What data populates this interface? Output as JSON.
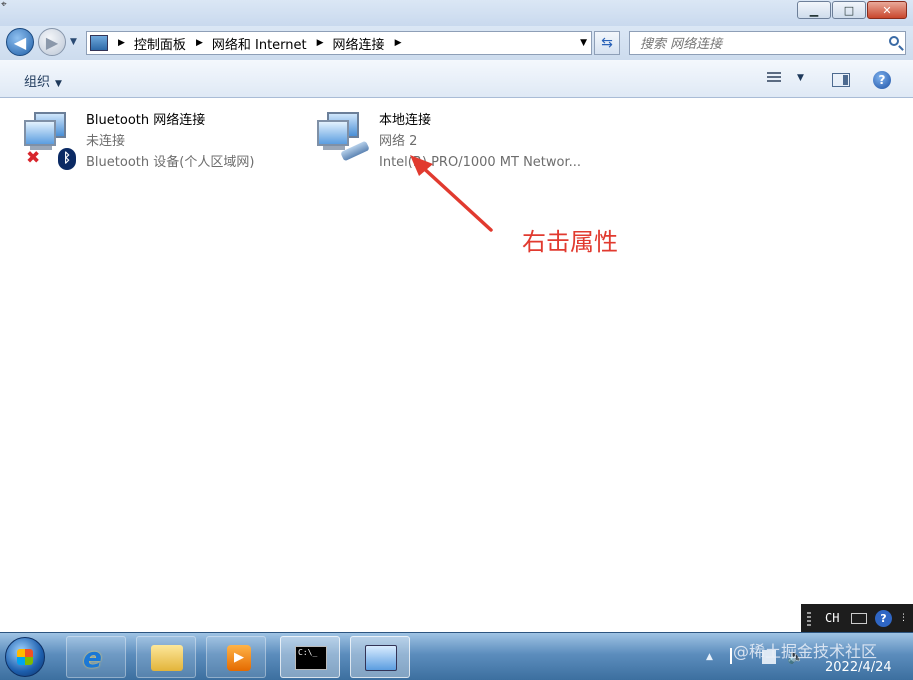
{
  "window": {
    "minimize_glyph": "▁",
    "maximize_glyph": "□",
    "close_glyph": "✕"
  },
  "nav": {
    "breadcrumb": [
      "控制面板",
      "网络和 Internet",
      "网络连接"
    ],
    "search_placeholder": "搜索 网络连接"
  },
  "toolbar": {
    "organize_label": "组织"
  },
  "connections": [
    {
      "name": "Bluetooth 网络连接",
      "status": "未连接",
      "device": "Bluetooth 设备(个人区域网)",
      "icon": "network-disconnected-icon"
    },
    {
      "name": "本地连接",
      "status": "网络  2",
      "device": "Intel(R) PRO/1000 MT Networ...",
      "icon": "network-cable-icon"
    }
  ],
  "annotation": {
    "text": "右击属性",
    "color": "#e13a2f"
  },
  "taskbar": {
    "language": "CH",
    "watermark": "@稀土掘金技术社区",
    "date": "2022/4/24",
    "cmd_prompt": "C:\\_"
  },
  "colors": {
    "accent": "#1e395b",
    "annotation_red": "#e13a2f"
  }
}
